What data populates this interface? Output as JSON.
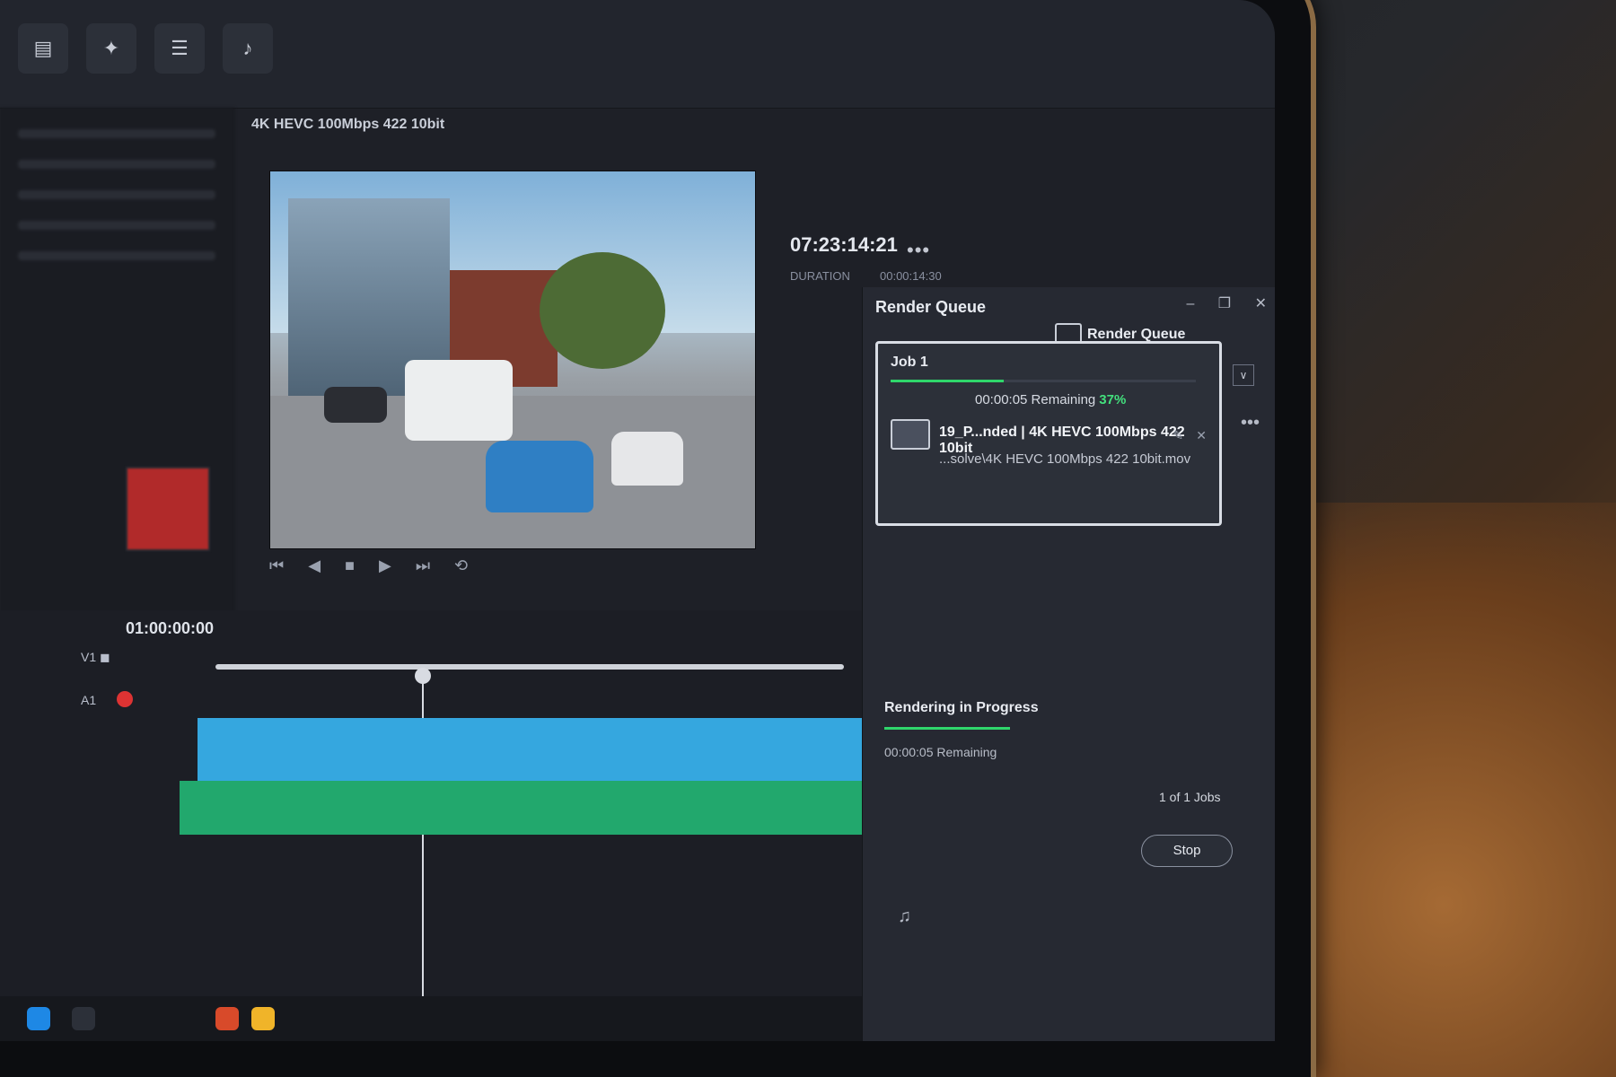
{
  "topbar": {
    "tools": [
      {
        "icon": "media-pool-icon",
        "label": ""
      },
      {
        "icon": "effects-icon",
        "label": ""
      },
      {
        "icon": "edit-index-icon",
        "label": ""
      },
      {
        "icon": "sound-library-icon",
        "label": ""
      }
    ]
  },
  "viewer": {
    "title": "4K HEVC 100Mbps 422 10bit",
    "timecode": "07:23:14:21",
    "duration_label": "DURATION",
    "duration_value": "00:00:14:30"
  },
  "render_queue": {
    "title": "Render Queue",
    "header_label": "Render Queue",
    "job": {
      "label": "Job 1",
      "remaining": "00:00:05 Remaining",
      "percent": "37%",
      "progress": 0.37,
      "name": "19_P...nded | 4K HEVC 100Mbps 422 10bit",
      "path": "...solve\\4K HEVC 100Mbps 422 10bit.mov"
    },
    "status": {
      "title": "Rendering in Progress",
      "remaining": "00:00:05 Remaining",
      "jobs_count": "1 of 1 Jobs",
      "stop_label": "Stop"
    }
  },
  "timeline": {
    "timecode": "01:00:00:00"
  },
  "colors": {
    "progress": "#2fd66b",
    "accent_blue": "#35a7df",
    "accent_green": "#22a86d"
  }
}
